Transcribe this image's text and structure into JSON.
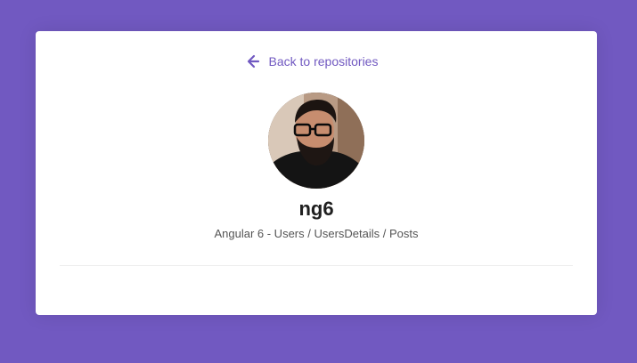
{
  "colors": {
    "page_background": "#7159c1",
    "card_background": "#ffffff",
    "accent": "#7159c1",
    "title": "#1f1f1f",
    "description": "#555555",
    "divider": "#eeeeee"
  },
  "header": {
    "back_icon": "arrow-left-icon",
    "back_label": "Back to repositories"
  },
  "owner": {
    "avatar_icon": "avatar"
  },
  "repository": {
    "name": "ng6",
    "description": "Angular 6 - Users / UsersDetails / Posts"
  }
}
